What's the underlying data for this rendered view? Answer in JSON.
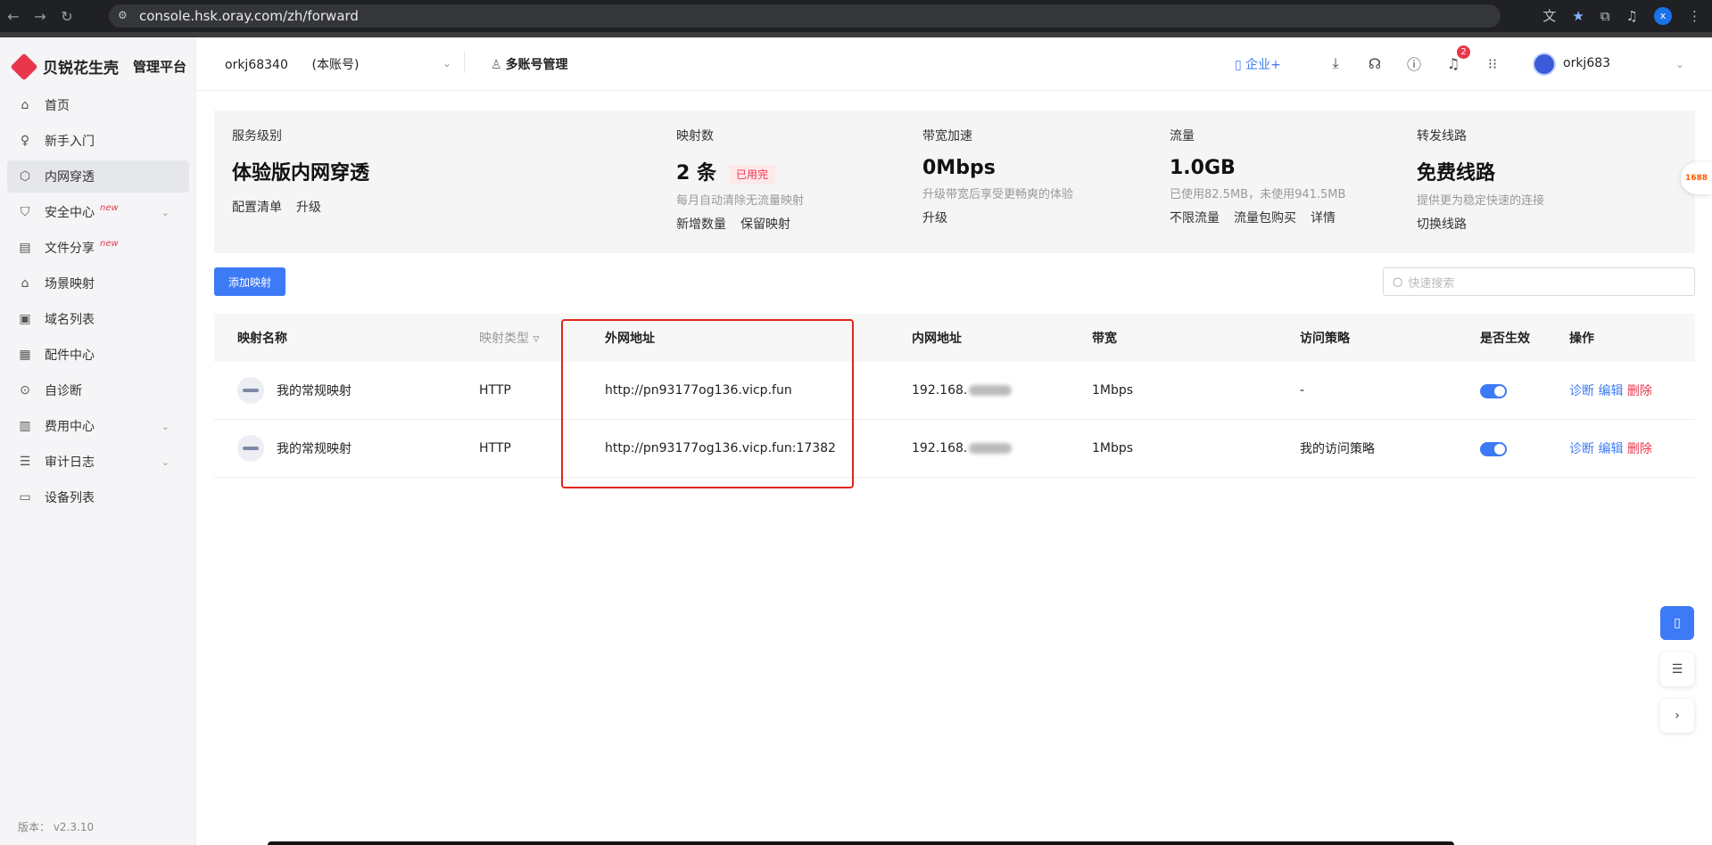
{
  "browser": {
    "url": "console.hsk.oray.com/zh/forward",
    "profile_initial": "x"
  },
  "sidebar": {
    "brand": "贝锐花生壳",
    "subtitle": "管理平台",
    "items": [
      {
        "label": "首页",
        "icon": "home-icon"
      },
      {
        "label": "新手入门",
        "icon": "lightbulb-icon"
      },
      {
        "label": "内网穿透",
        "icon": "cube-icon",
        "active": true
      },
      {
        "label": "安全中心",
        "icon": "shield-icon",
        "new": "new"
      },
      {
        "label": "文件分享",
        "icon": "file-share-icon",
        "new": "new"
      },
      {
        "label": "场景映射",
        "icon": "scene-icon"
      },
      {
        "label": "域名列表",
        "icon": "domain-icon"
      },
      {
        "label": "配件中心",
        "icon": "grid-icon"
      },
      {
        "label": "自诊断",
        "icon": "diagnose-icon"
      },
      {
        "label": "费用中心",
        "icon": "billing-icon"
      },
      {
        "label": "审计日志",
        "icon": "log-icon"
      },
      {
        "label": "设备列表",
        "icon": "monitor-icon"
      }
    ],
    "version": "版本： v2.3.10"
  },
  "header": {
    "account": "orkj68340      (本账号)",
    "multi_account": "多账号管理",
    "enterprise": "企业+",
    "notification_count": "2",
    "username": "orkj683"
  },
  "stats": {
    "service": {
      "label": "服务级别",
      "value": "体验版内网穿透",
      "links": [
        "配置清单",
        "升级"
      ]
    },
    "mappings": {
      "label": "映射数",
      "value": "2 条",
      "tag": "已用完",
      "desc": "每月自动清除无流量映射",
      "links": [
        "新增数量",
        "保留映射"
      ]
    },
    "bandwidth": {
      "label": "带宽加速",
      "value": "0Mbps",
      "desc": "升级带宽后享受更畅爽的体验",
      "links": [
        "升级"
      ]
    },
    "traffic": {
      "label": "流量",
      "value": "1.0GB",
      "desc": "已使用82.5MB，未使用941.5MB",
      "links": [
        "不限流量",
        "流量包购买",
        "详情"
      ]
    },
    "route": {
      "label": "转发线路",
      "value": "免费线路",
      "desc": "提供更为稳定快速的连接",
      "links": [
        "切换线路"
      ]
    }
  },
  "toolbar": {
    "add_label": "添加映射",
    "search_placeholder": "快速搜索"
  },
  "table": {
    "headers": {
      "name": "映射名称",
      "type": "映射类型",
      "external": "外网地址",
      "internal": "内网地址",
      "bandwidth": "带宽",
      "policy": "访问策略",
      "enabled": "是否生效",
      "actions": "操作"
    },
    "rows": [
      {
        "name": "我的常规映射",
        "type": "HTTP",
        "external": "http://pn93177og136.vicp.fun",
        "internal": "192.168.",
        "bandwidth": "1Mbps",
        "policy": "-",
        "enabled": true
      },
      {
        "name": "我的常规映射",
        "type": "HTTP",
        "external": "http://pn93177og136.vicp.fun:17382",
        "internal": "192.168.",
        "bandwidth": "1Mbps",
        "policy": "我的访问策略",
        "enabled": true
      }
    ],
    "actions": {
      "diagnose": "诊断",
      "edit": "编辑",
      "delete": "删除"
    }
  },
  "floating": {
    "side_badge": "1688"
  },
  "colors": {
    "primary": "#3d7af5",
    "danger": "#e8374c",
    "highlight": "#e0261a"
  }
}
